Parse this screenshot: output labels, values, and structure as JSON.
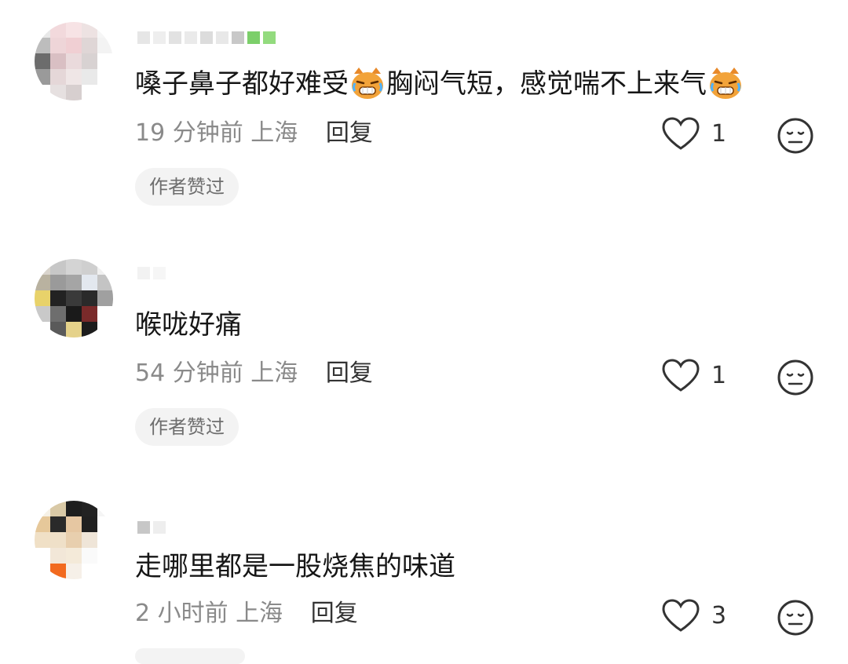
{
  "comments": [
    {
      "text_before": "嗓子鼻子都好难受",
      "emoji": "cat-crying-icon",
      "text_middle": "胸闷气短，感觉喘不上来气",
      "time": "19 分钟前",
      "location": "上海",
      "reply_label": "回复",
      "like_count": "1",
      "badge": "作者赞过"
    },
    {
      "text": "喉咙好痛",
      "time": "54 分钟前",
      "location": "上海",
      "reply_label": "回复",
      "like_count": "1",
      "badge": "作者赞过"
    },
    {
      "text": "走哪里都是一股烧焦的味道",
      "time": "2 小时前",
      "location": "上海",
      "reply_label": "回复",
      "like_count": "3"
    }
  ],
  "colors": {
    "text": "#161616",
    "meta": "#8a8a8a",
    "badge_bg": "#f3f3f3",
    "icon": "#333333"
  }
}
